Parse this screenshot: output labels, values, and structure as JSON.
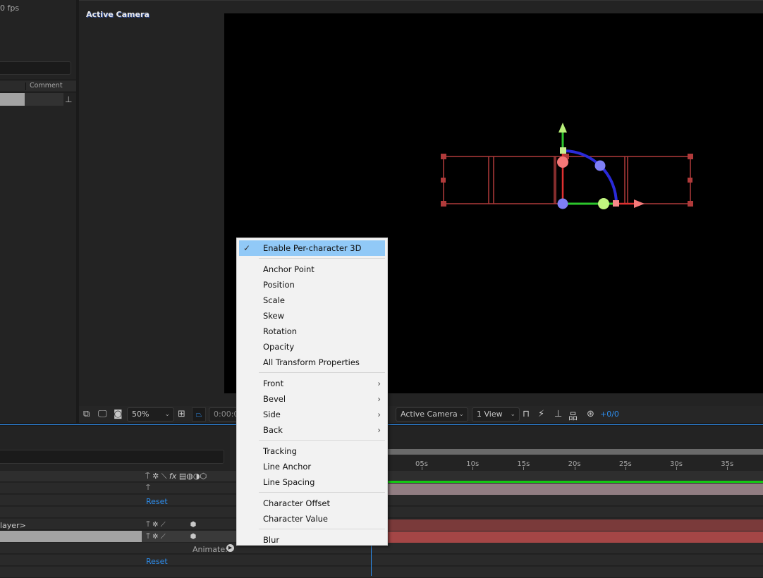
{
  "project_panel": {
    "fps_text": "0 fps",
    "column_comment": "Comment",
    "flowchart_icon": "flowchart-icon"
  },
  "viewer": {
    "label": "Active Camera",
    "toolbar": {
      "zoom": "50%",
      "timecode": "0:00:00",
      "camera": "Active Camera",
      "views": "1 View",
      "exposure": "+0/0"
    }
  },
  "context_menu": {
    "groups": [
      [
        {
          "label": "Enable Per-character 3D",
          "checked": true,
          "highlighted": true
        }
      ],
      [
        {
          "label": "Anchor Point"
        },
        {
          "label": "Position"
        },
        {
          "label": "Scale"
        },
        {
          "label": "Skew"
        },
        {
          "label": "Rotation"
        },
        {
          "label": "Opacity"
        },
        {
          "label": "All Transform Properties"
        }
      ],
      [
        {
          "label": "Front",
          "submenu": true
        },
        {
          "label": "Bevel",
          "submenu": true
        },
        {
          "label": "Side",
          "submenu": true
        },
        {
          "label": "Back",
          "submenu": true
        }
      ],
      [
        {
          "label": "Tracking"
        },
        {
          "label": "Line Anchor"
        },
        {
          "label": "Line Spacing"
        }
      ],
      [
        {
          "label": "Character Offset"
        },
        {
          "label": "Character Value"
        }
      ],
      [
        {
          "label": "Blur"
        }
      ]
    ]
  },
  "timeline": {
    "ruler": [
      "05s",
      "10s",
      "15s",
      "20s",
      "25s",
      "30s",
      "35s"
    ],
    "rows": {
      "reset_1": "Reset",
      "layer_name": "layer>",
      "animate": "Animate:",
      "reset_2": "Reset"
    },
    "switch_header_fx": "fx",
    "colors": {
      "work_area": "#14c814",
      "bar_mauve": "#917d82",
      "bar_dark_red": "#7a3a3a",
      "bar_red": "#a44646",
      "accent": "#2d8ceb"
    }
  }
}
